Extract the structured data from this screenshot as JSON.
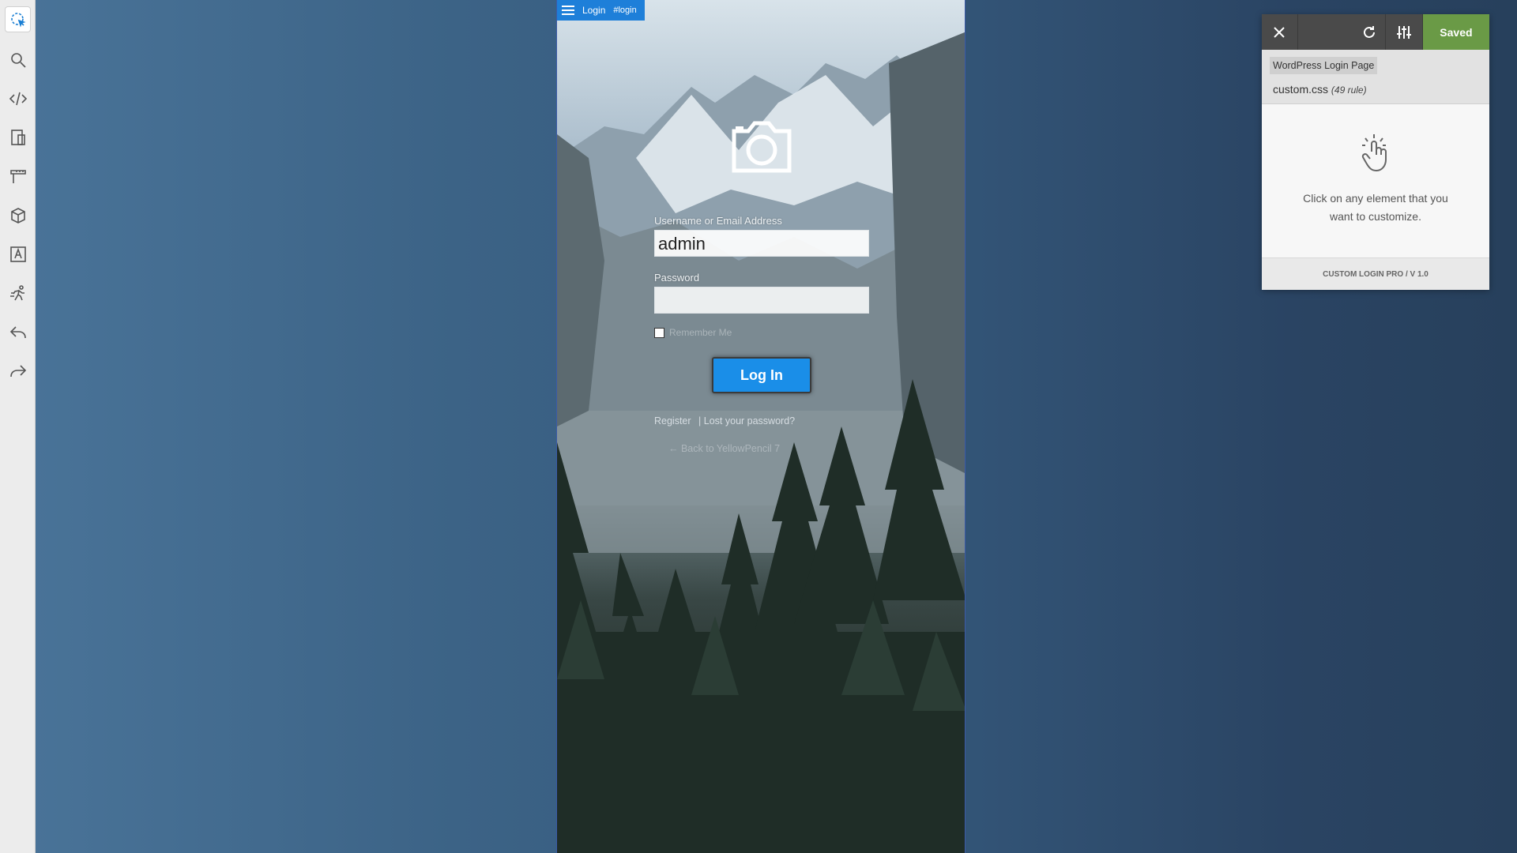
{
  "toolbar": {
    "tools": [
      "selector-icon",
      "search-icon",
      "code-icon",
      "responsive-icon",
      "measure-icon",
      "3d-box-icon",
      "typography-icon",
      "animation-icon",
      "undo-icon",
      "redo-icon"
    ]
  },
  "preview": {
    "breadcrumb": {
      "label": "Login",
      "tag": "#login"
    },
    "form": {
      "username_label": "Username or Email Address",
      "username_value": "admin",
      "password_label": "Password",
      "remember_label": "Remember Me",
      "login_button": "Log In"
    },
    "links": {
      "register": "Register",
      "separator": "|",
      "lost_password": "Lost your password?"
    },
    "back_link": "← Back to YellowPencil 7"
  },
  "panel": {
    "saved_label": "Saved",
    "page_name": "WordPress Login Page",
    "css_file": "custom.css",
    "css_rules": "(49 rule)",
    "hint_line1": "Click on any element that you",
    "hint_line2": "want to customize.",
    "footer": "CUSTOM LOGIN PRO / V 1.0"
  },
  "colors": {
    "accent": "#1a8ee8",
    "saved": "#6a9a46",
    "panel_dark": "#4a4a4a"
  }
}
